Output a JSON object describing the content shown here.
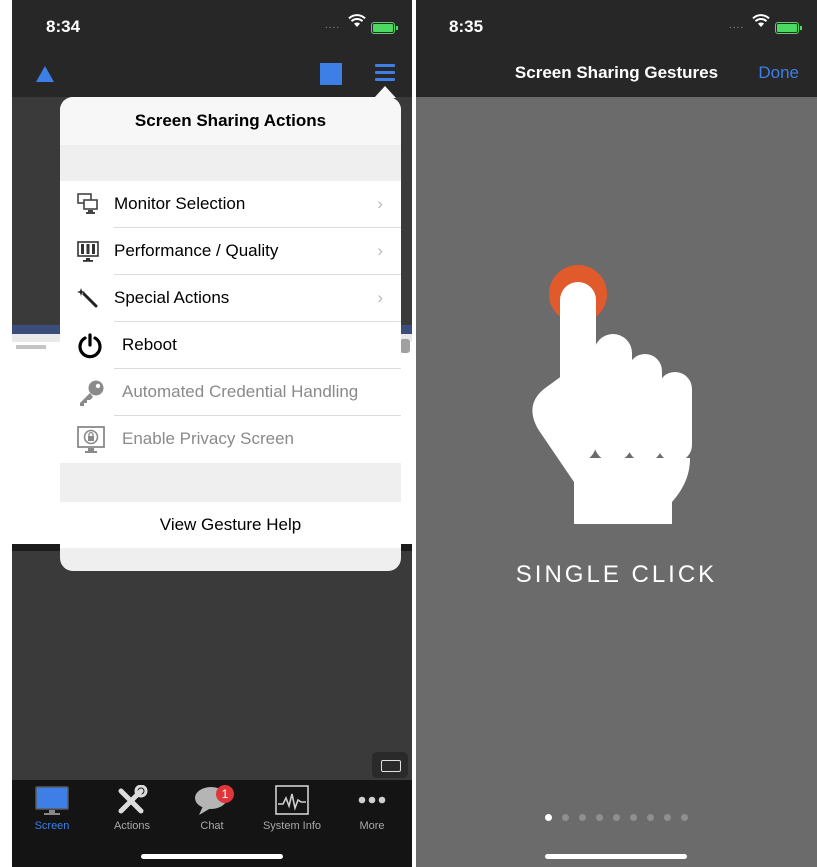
{
  "left_screen": {
    "status_time": "8:34",
    "signal_dots": "....",
    "popover": {
      "title": "Screen Sharing Actions",
      "items": [
        {
          "label": "Monitor Selection",
          "icon": "monitor-icon",
          "chevron": "›",
          "enabled": true
        },
        {
          "label": "Performance / Quality",
          "icon": "performance-icon",
          "chevron": "›",
          "enabled": true
        },
        {
          "label": "Special Actions",
          "icon": "magic-wand-icon",
          "chevron": "›",
          "enabled": true
        },
        {
          "label": "Reboot",
          "icon": "power-icon",
          "chevron": "",
          "enabled": true
        },
        {
          "label": "Automated Credential Handling",
          "icon": "key-icon",
          "chevron": "",
          "enabled": false
        },
        {
          "label": "Enable Privacy Screen",
          "icon": "privacy-lock-icon",
          "chevron": "",
          "enabled": false
        }
      ],
      "footer_button": "View Gesture Help"
    },
    "tabs": [
      {
        "label": "Screen",
        "icon": "monitor-icon",
        "active": true
      },
      {
        "label": "Actions",
        "icon": "tools-icon",
        "active": false
      },
      {
        "label": "Chat",
        "icon": "chat-bubble-icon",
        "active": false,
        "badge": "1"
      },
      {
        "label": "System Info",
        "icon": "system-graph-icon",
        "active": false
      },
      {
        "label": "More",
        "icon": "more-dots-icon",
        "active": false
      }
    ]
  },
  "right_screen": {
    "status_time": "8:35",
    "signal_dots": "....",
    "nav_title": "Screen Sharing Gestures",
    "done_label": "Done",
    "gesture_label": "SINGLE CLICK",
    "pager": {
      "total": 9,
      "current": 1
    }
  },
  "colors": {
    "accent": "#3d7fe6",
    "tap_indicator": "#e05a2b",
    "badge": "#e0353b",
    "battery": "#4cd964"
  }
}
